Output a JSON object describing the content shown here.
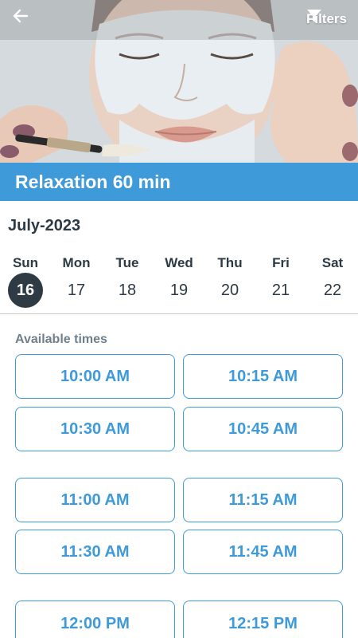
{
  "header": {
    "filters_label": "Filters",
    "back_icon": "arrow-left-icon",
    "filter_icon": "funnel-icon",
    "hero_image": "facial-mask-treatment-photo"
  },
  "service": {
    "title": "Relaxation 60 min"
  },
  "calendar": {
    "month_label": "July-2023",
    "days": [
      {
        "name": "Sun",
        "num": "16",
        "selected": true
      },
      {
        "name": "Mon",
        "num": "17",
        "selected": false
      },
      {
        "name": "Tue",
        "num": "18",
        "selected": false
      },
      {
        "name": "Wed",
        "num": "19",
        "selected": false
      },
      {
        "name": "Thu",
        "num": "20",
        "selected": false
      },
      {
        "name": "Fri",
        "num": "21",
        "selected": false
      },
      {
        "name": "Sat",
        "num": "22",
        "selected": false
      }
    ]
  },
  "times": {
    "label": "Available times",
    "slots": [
      "10:00 AM",
      "10:15 AM",
      "10:30 AM",
      "10:45 AM",
      "11:00 AM",
      "11:15 AM",
      "11:30 AM",
      "11:45 AM",
      "12:00 PM",
      "12:15 PM"
    ]
  },
  "colors": {
    "accent": "#3e9ad8",
    "selected_day": "#2f3b44",
    "text_dark": "#2d3a45",
    "text_muted": "#6f7f8c"
  }
}
